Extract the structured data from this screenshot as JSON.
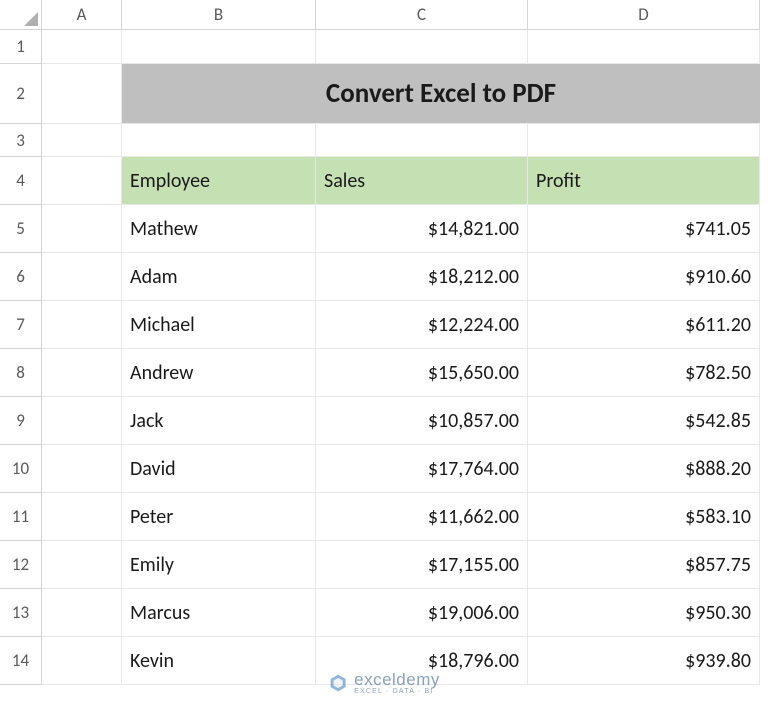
{
  "columns": [
    "A",
    "B",
    "C",
    "D"
  ],
  "rows": [
    "1",
    "2",
    "3",
    "4",
    "5",
    "6",
    "7",
    "8",
    "9",
    "10",
    "11",
    "12",
    "13",
    "14"
  ],
  "title": "Convert Excel to PDF",
  "headers": {
    "employee": "Employee",
    "sales": "Sales",
    "profit": "Profit"
  },
  "data": [
    {
      "employee": "Mathew",
      "sales": "$14,821.00",
      "profit": "$741.05"
    },
    {
      "employee": "Adam",
      "sales": "$18,212.00",
      "profit": "$910.60"
    },
    {
      "employee": "Michael",
      "sales": "$12,224.00",
      "profit": "$611.20"
    },
    {
      "employee": "Andrew",
      "sales": "$15,650.00",
      "profit": "$782.50"
    },
    {
      "employee": "Jack",
      "sales": "$10,857.00",
      "profit": "$542.85"
    },
    {
      "employee": "David",
      "sales": "$17,764.00",
      "profit": "$888.20"
    },
    {
      "employee": "Peter",
      "sales": "$11,662.00",
      "profit": "$583.10"
    },
    {
      "employee": "Emily",
      "sales": "$17,155.00",
      "profit": "$857.75"
    },
    {
      "employee": "Marcus",
      "sales": "$19,006.00",
      "profit": "$950.30"
    },
    {
      "employee": "Kevin",
      "sales": "$18,796.00",
      "profit": "$939.80"
    }
  ],
  "watermark": {
    "brand": "exceldemy",
    "tagline": "EXCEL · DATA · BI"
  }
}
